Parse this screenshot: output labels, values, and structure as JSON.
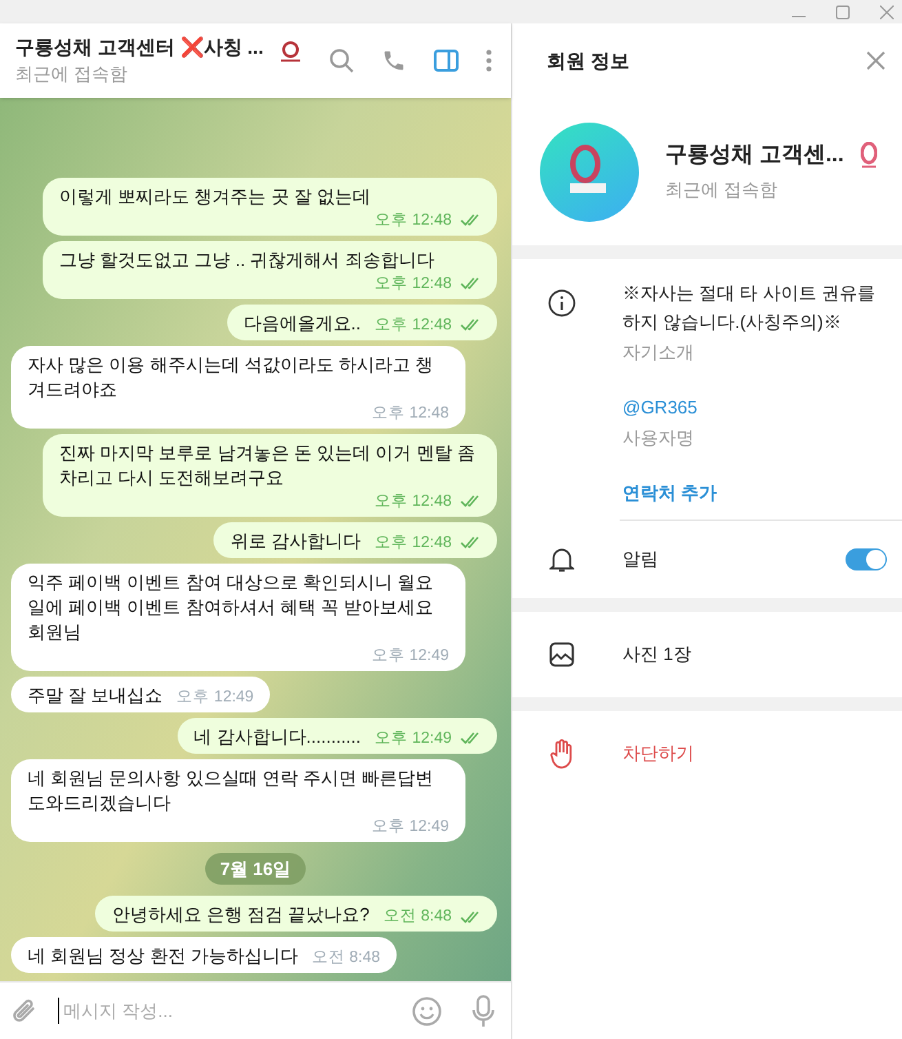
{
  "chat_header": {
    "title": "구룡성채 고객센터 ❌사칭 ...",
    "status": "최근에 접속함",
    "panel_toggle_selected": true
  },
  "messages": [
    {
      "kind": "out",
      "text": "이렇게 뽀찌라도 챙겨주는 곳 잘 없는데",
      "time": "오후 12:48",
      "read": true
    },
    {
      "kind": "out",
      "text": "그냥 할것도없고 그냥 .. 귀찮게해서 죄송합니다",
      "time": "오후 12:48",
      "read": true
    },
    {
      "kind": "out",
      "text": "다음에올게요..",
      "time": "오후 12:48",
      "read": true
    },
    {
      "kind": "in",
      "text": "자사 많은 이용 해주시는데 석값이라도 하시라고 챙겨드려야죠",
      "time": "오후 12:48"
    },
    {
      "kind": "out",
      "text": "진짜 마지막 보루로 남겨놓은 돈 있는데 이거 멘탈 좀 차리고 다시 도전해보려구요",
      "time": "오후 12:48",
      "read": true
    },
    {
      "kind": "out",
      "text": "위로 감사합니다",
      "time": "오후 12:48",
      "read": true
    },
    {
      "kind": "in",
      "text": "익주 페이백 이벤트 참여 대상으로 확인되시니 월요일에 페이백 이벤트 참여하셔서 혜택 꼭 받아보세요 회원님",
      "time": "오후 12:49"
    },
    {
      "kind": "in",
      "text": "주말 잘 보내십쇼",
      "time": "오후 12:49"
    },
    {
      "kind": "out",
      "text": "네 감사합니다...........",
      "time": "오후 12:49",
      "read": true
    },
    {
      "kind": "in",
      "text": "네 회원님 문의사항 있으실때 연락 주시면 빠른답변 도와드리겠습니다",
      "time": "오후 12:49"
    },
    {
      "kind": "date",
      "text": "7월 16일"
    },
    {
      "kind": "out",
      "text": "안녕하세요 은행 점검 끝났나요?",
      "time": "오전 8:48",
      "read": true
    },
    {
      "kind": "in",
      "text": "네 회원님 정상 환전 가능하십니다",
      "time": "오전 8:48"
    }
  ],
  "composer": {
    "placeholder": "메시지 작성..."
  },
  "info_panel": {
    "title": "회원 정보",
    "profile": {
      "name": "구룡성채 고객센...",
      "status": "최근에 접속함"
    },
    "bio": "※자사는 절대 타 사이트 권유를 하지 않습니다.(사칭주의)※",
    "bio_label": "자기소개",
    "username": "@GR365",
    "username_label": "사용자명",
    "add_contact": "연락처 추가",
    "notifications": {
      "label": "알림",
      "on": true
    },
    "media": "사진 1장",
    "block": "차단하기"
  }
}
